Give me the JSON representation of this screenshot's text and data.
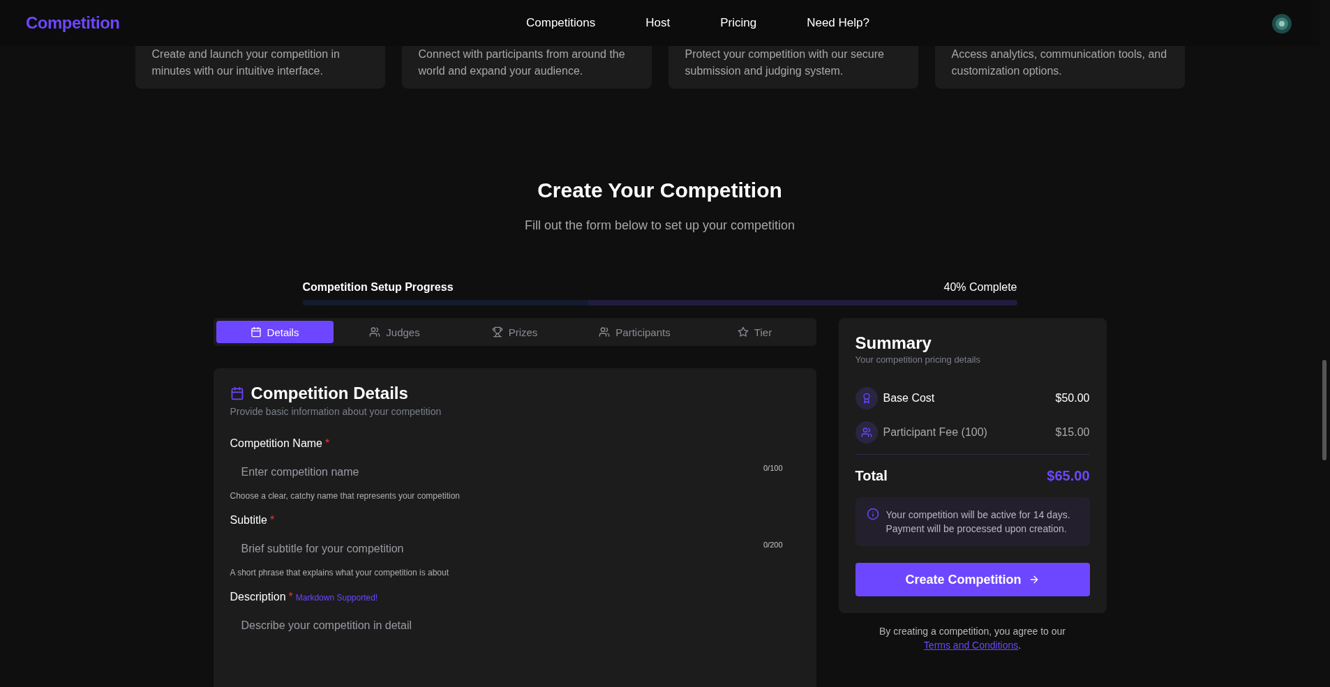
{
  "header": {
    "logo": "Competition",
    "nav": [
      {
        "label": "Competitions"
      },
      {
        "label": "Host"
      },
      {
        "label": "Pricing"
      },
      {
        "label": "Need Help?"
      }
    ]
  },
  "features": [
    {
      "text": "Create and launch your competition in minutes with our intuitive interface."
    },
    {
      "text": "Connect with participants from around the world and expand your audience."
    },
    {
      "text": "Protect your competition with our secure submission and judging system."
    },
    {
      "text": "Access analytics, communication tools, and customization options."
    }
  ],
  "page": {
    "title": "Create Your Competition",
    "subtitle": "Fill out the form below to set up your competition"
  },
  "progress": {
    "label": "Competition Setup Progress",
    "reading": "40% Complete",
    "level": 0.4
  },
  "tabs": [
    {
      "label": "Details",
      "selected": true
    },
    {
      "label": "Judges",
      "selected": false
    },
    {
      "label": "Prizes",
      "selected": false
    },
    {
      "label": "Participants",
      "selected": false
    },
    {
      "label": "Tier",
      "selected": false
    }
  ],
  "form": {
    "title": "Competition Details",
    "subtitle": "Provide basic information about your competition",
    "fields": [
      {
        "label": "Competition Name",
        "required_mark": "*",
        "placeholder": "Enter competition name",
        "counter": "0/100",
        "help": "Choose a clear, catchy name that represents your competition",
        "kind": "input"
      },
      {
        "label": "Subtitle",
        "required_mark": "*",
        "placeholder": "Brief subtitle for your competition",
        "counter": "0/200",
        "help": "A short phrase that explains what your competition is about",
        "kind": "input"
      },
      {
        "label": "Description",
        "required_mark": "*",
        "note": "Markdown Supported!",
        "placeholder": "Describe your competition in detail",
        "kind": "textarea"
      }
    ]
  },
  "summary": {
    "title": "Summary",
    "subtitle": "Your competition pricing details",
    "items": [
      {
        "label": "Base Cost",
        "amount": "$50.00"
      },
      {
        "label": "Participant Fee (100)",
        "amount": "$15.00"
      }
    ],
    "total_label": "Total",
    "total": "$65.00",
    "info": [
      "Your competition will be active for 14 days.",
      "Payment will be processed upon creation."
    ],
    "button": "Create Competition",
    "terms": {
      "text": "By creating a competition, you agree to our ",
      "link": "Terms and Conditions",
      "end": "."
    }
  }
}
